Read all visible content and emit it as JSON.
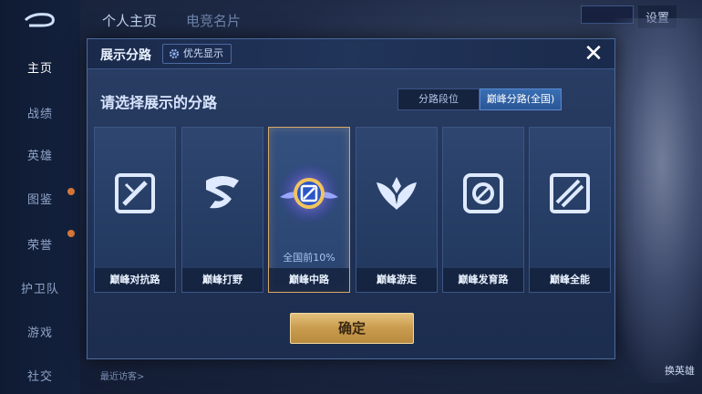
{
  "sidebar": {
    "items": [
      {
        "label": "主页",
        "active": true
      },
      {
        "label": "战绩",
        "active": false
      },
      {
        "label": "英雄",
        "active": false
      },
      {
        "label": "图鉴",
        "active": false
      },
      {
        "label": "荣誉",
        "active": false
      },
      {
        "label": "护卫队",
        "active": false
      },
      {
        "label": "游戏",
        "active": false
      },
      {
        "label": "社交",
        "active": false
      }
    ]
  },
  "topbar": {
    "tabs": [
      "个人主页",
      "电竞名片"
    ],
    "settings_label": "设置"
  },
  "background": {
    "visitor_label": "最近访客>",
    "right_label": "换英雄"
  },
  "modal": {
    "title": "展示分路",
    "priority_label": "优先显示",
    "close_icon": "close-icon",
    "prompt": "请选择展示的分路",
    "toggles": [
      {
        "label": "分路段位",
        "active": false
      },
      {
        "label": "巅峰分路(全国)",
        "active": true
      }
    ],
    "cards": [
      {
        "name": "巅峰对抗路",
        "icon": "clash-lane-icon",
        "selected": false,
        "rank": ""
      },
      {
        "name": "巅峰打野",
        "icon": "jungle-icon",
        "selected": false,
        "rank": ""
      },
      {
        "name": "巅峰中路",
        "icon": "mid-lane-icon",
        "selected": true,
        "rank": "全国前10%"
      },
      {
        "name": "巅峰游走",
        "icon": "roam-icon",
        "selected": false,
        "rank": ""
      },
      {
        "name": "巅峰发育路",
        "icon": "farm-lane-icon",
        "selected": false,
        "rank": ""
      },
      {
        "name": "巅峰全能",
        "icon": "all-round-icon",
        "selected": false,
        "rank": ""
      }
    ],
    "confirm_label": "确定"
  },
  "colors": {
    "accent_gold": "#d9a866",
    "active_blue": "#3a6fb5",
    "panel_bg": "#22375d"
  }
}
